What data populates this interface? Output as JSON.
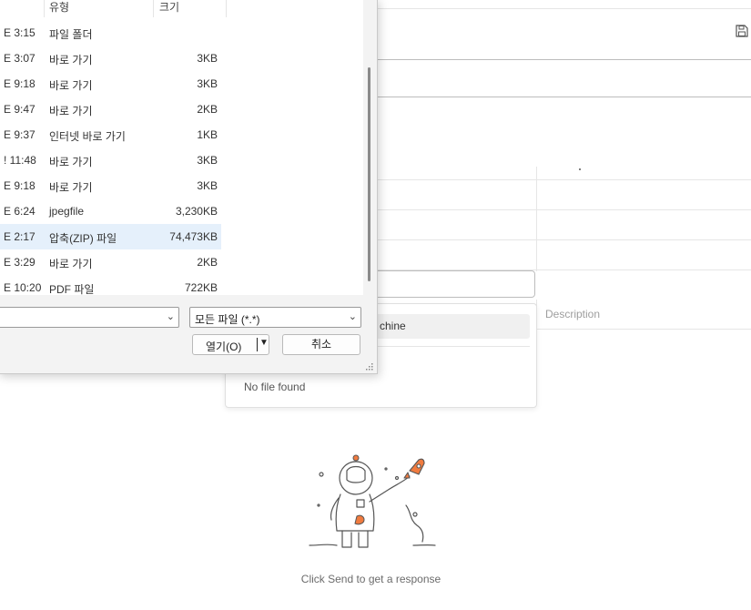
{
  "file_dialog": {
    "columns": {
      "type": "유형",
      "size": "크기"
    },
    "rows": [
      {
        "date": "E 3:15",
        "type": "파일 폴더",
        "size": ""
      },
      {
        "date": "E 3:07",
        "type": "바로 가기",
        "size": "3KB"
      },
      {
        "date": "E 9:18",
        "type": "바로 가기",
        "size": "3KB"
      },
      {
        "date": "E 9:47",
        "type": "바로 가기",
        "size": "2KB"
      },
      {
        "date": "E 9:37",
        "type": "인터넷 바로 가기",
        "size": "1KB"
      },
      {
        "date": "! 11:48",
        "type": "바로 가기",
        "size": "3KB"
      },
      {
        "date": "E 9:18",
        "type": "바로 가기",
        "size": "3KB"
      },
      {
        "date": "E 6:24",
        "type": "jpegfile",
        "size": "3,230KB"
      },
      {
        "date": "E 2:17",
        "type": "압축(ZIP) 파일",
        "size": "74,473KB"
      },
      {
        "date": "E 3:29",
        "type": "바로 가기",
        "size": "2KB"
      },
      {
        "date": "E 10:20",
        "type": "PDF 파일",
        "size": "722KB"
      }
    ],
    "selected_row": 8,
    "file_type_filter": "모든 파일 (*.*)",
    "open_button": "열기(O)",
    "cancel_button": "취소"
  },
  "background": {
    "key_table_header_description": "Description",
    "dropdown": {
      "option_label": "chine",
      "empty_message": "No file found"
    },
    "response_empty_text": "Click Send to get a response"
  },
  "icons": {
    "save": "save-icon",
    "chevron": "chevron-down-icon",
    "illustration": "astronaut-rocket-illustration"
  },
  "colors": {
    "selection": "#e5f0fb",
    "dialog_bg": "#f3f3f3",
    "accent_orange": "#f07b3f"
  }
}
